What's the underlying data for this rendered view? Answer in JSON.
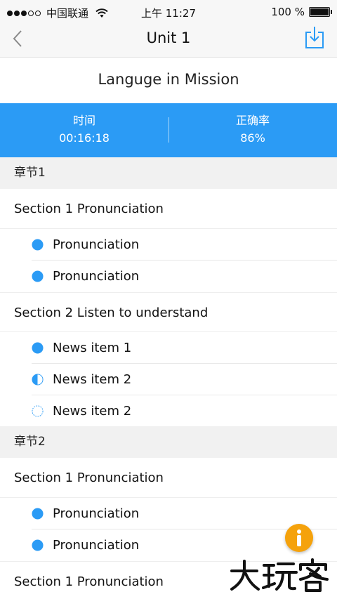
{
  "status_bar": {
    "carrier": "中国联通",
    "time": "上午 11:27",
    "battery": "100 %"
  },
  "nav": {
    "title": "Unit 1",
    "back_icon": "chevron-left-icon",
    "download_icon": "download-icon"
  },
  "subtitle": "Languge in Mission",
  "stats": {
    "time_label": "时间",
    "time_value": "00:16:18",
    "accuracy_label": "正确率",
    "accuracy_value": "86%"
  },
  "chapters": [
    {
      "title": "章节1",
      "sections": [
        {
          "title": "Section 1 Pronunciation",
          "items": [
            {
              "label": "Pronunciation",
              "status": "complete"
            },
            {
              "label": "Pronunciation",
              "status": "complete"
            }
          ]
        },
        {
          "title": "Section 2 Listen to understand",
          "items": [
            {
              "label": "News item 1",
              "status": "complete"
            },
            {
              "label": "News item 2",
              "status": "half"
            },
            {
              "label": "News item 2",
              "status": "empty"
            }
          ]
        }
      ]
    },
    {
      "title": "章节2",
      "sections": [
        {
          "title": "Section 1 Pronunciation",
          "items": [
            {
              "label": "Pronunciation",
              "status": "complete"
            },
            {
              "label": "Pronunciation",
              "status": "complete"
            }
          ]
        },
        {
          "title": "Section 1 Pronunciation",
          "items": []
        }
      ]
    }
  ],
  "fab_icon": "info-icon",
  "watermark": "大玩客",
  "colors": {
    "accent": "#2b9bf5",
    "fab": "#f5a20c",
    "chapter_bg": "#f1f1f1"
  }
}
